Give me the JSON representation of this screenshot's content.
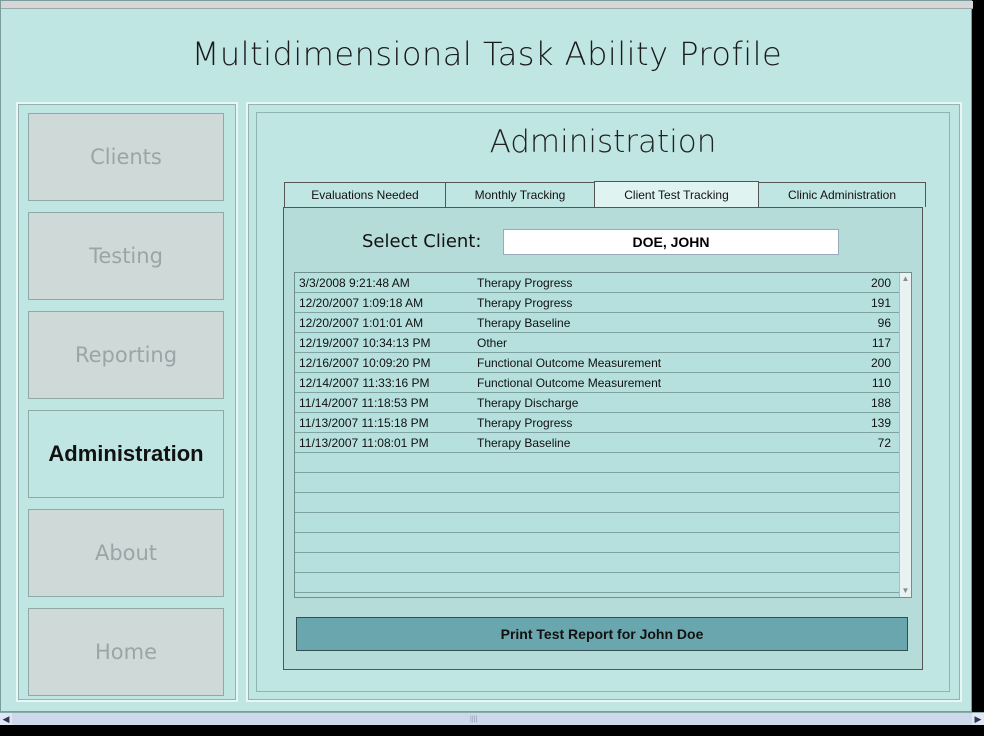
{
  "app": {
    "title": "Multidimensional Task Ability Profile"
  },
  "sidebar": {
    "items": [
      {
        "label": "Clients",
        "active": false
      },
      {
        "label": "Testing",
        "active": false
      },
      {
        "label": "Reporting",
        "active": false
      },
      {
        "label": "Administration",
        "active": true
      },
      {
        "label": "About",
        "active": false
      },
      {
        "label": "Home",
        "active": false
      }
    ]
  },
  "main": {
    "section_title": "Administration",
    "tabs": [
      {
        "label": "Evaluations Needed",
        "active": false
      },
      {
        "label": "Monthly Tracking",
        "active": false
      },
      {
        "label": "Client Test Tracking",
        "active": true
      },
      {
        "label": "Clinic Administration",
        "active": false
      }
    ],
    "select_client": {
      "label": "Select Client:",
      "value": "DOE, JOHN"
    },
    "test_rows": [
      {
        "date": "3/3/2008 9:21:48 AM",
        "type": "Therapy Progress",
        "score": "200"
      },
      {
        "date": "12/20/2007 1:09:18 AM",
        "type": "Therapy Progress",
        "score": "191"
      },
      {
        "date": "12/20/2007 1:01:01 AM",
        "type": "Therapy Baseline",
        "score": "96"
      },
      {
        "date": "12/19/2007 10:34:13 PM",
        "type": "Other",
        "score": "117"
      },
      {
        "date": "12/16/2007 10:09:20 PM",
        "type": "Functional Outcome Measurement",
        "score": "200"
      },
      {
        "date": "12/14/2007 11:33:16 PM",
        "type": "Functional Outcome Measurement",
        "score": "110"
      },
      {
        "date": "11/14/2007 11:18:53 PM",
        "type": "Therapy Discharge",
        "score": "188"
      },
      {
        "date": "11/13/2007 11:15:18 PM",
        "type": "Therapy Progress",
        "score": "139"
      },
      {
        "date": "11/13/2007 11:08:01 PM",
        "type": "Therapy Baseline",
        "score": "72"
      },
      {
        "date": "",
        "type": "",
        "score": ""
      },
      {
        "date": "",
        "type": "",
        "score": ""
      },
      {
        "date": "",
        "type": "",
        "score": ""
      },
      {
        "date": "",
        "type": "",
        "score": ""
      },
      {
        "date": "",
        "type": "",
        "score": ""
      },
      {
        "date": "",
        "type": "",
        "score": ""
      },
      {
        "date": "",
        "type": "",
        "score": ""
      }
    ],
    "print_button": "Print Test Report for John Doe"
  }
}
